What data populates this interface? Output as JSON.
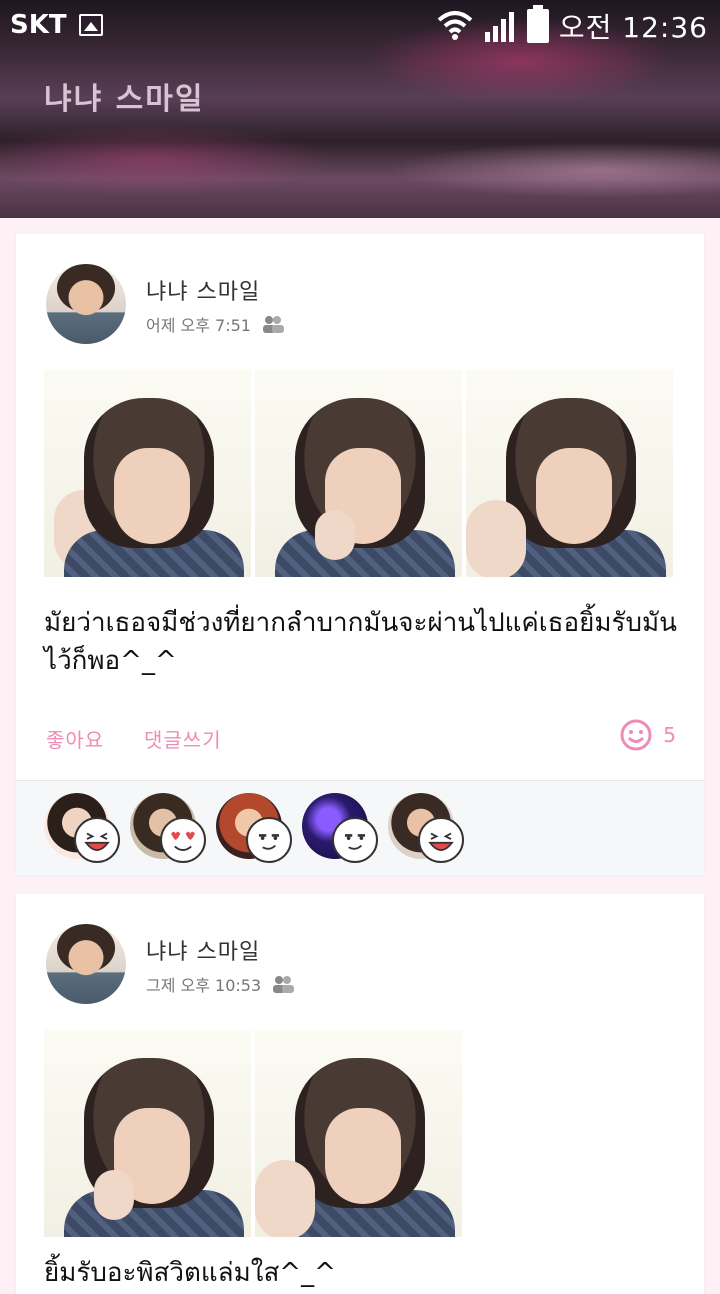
{
  "status_bar": {
    "carrier": "SKT",
    "time": "오전 12:36"
  },
  "cover": {
    "title": "냐냐 스마일"
  },
  "posts": [
    {
      "author": "냐냐 스마일",
      "timestamp": "어제 오후 7:51",
      "text": "มัยว่าเธอจมีช่วงที่ยากลำบากมันจะผ่านไปแค่เธอยิ้มรับมัน ไว้ก็พอ^_^",
      "like_label": "좋아요",
      "comment_label": "댓글쓰기",
      "emotion_count": "5",
      "photo_count": 3,
      "reactions": [
        "laugh-emoji",
        "heart-eyes-emoji",
        "smirk-emoji",
        "smirk-emoji",
        "laugh-emoji"
      ]
    },
    {
      "author": "냐냐 스마일",
      "timestamp": "그제 오후 10:53",
      "text": "ยิ้มรับอะพิสวิตแล่มใส^_^",
      "photo_count": 2
    }
  ],
  "colors": {
    "accent": "#ee8cb4",
    "background": "#fdf1f6"
  }
}
